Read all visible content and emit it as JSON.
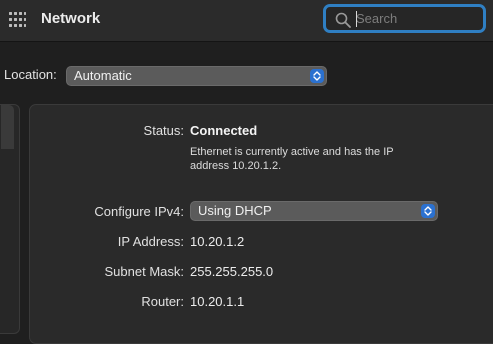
{
  "toolbar": {
    "title": "Network",
    "search": {
      "placeholder": "Search",
      "value": ""
    }
  },
  "location": {
    "label": "Location:",
    "selected": "Automatic"
  },
  "status": {
    "label": "Status:",
    "value": "Connected",
    "description": "Ethernet is currently active and has the IP address 10.20.1.2."
  },
  "configure_ipv4": {
    "label": "Configure IPv4:",
    "selected": "Using DHCP"
  },
  "ip_address": {
    "label": "IP Address:",
    "value": "10.20.1.2"
  },
  "subnet_mask": {
    "label": "Subnet Mask:",
    "value": "255.255.255.0"
  },
  "router": {
    "label": "Router:",
    "value": "10.20.1.1"
  },
  "icons": [
    "grid-icon",
    "search-icon",
    "chevron-updown-icon"
  ],
  "colors": {
    "accent": "#2f7fc3",
    "stepper": "#2b71d0",
    "background": "#1f1f1f",
    "panel": "#2a2a2a"
  }
}
